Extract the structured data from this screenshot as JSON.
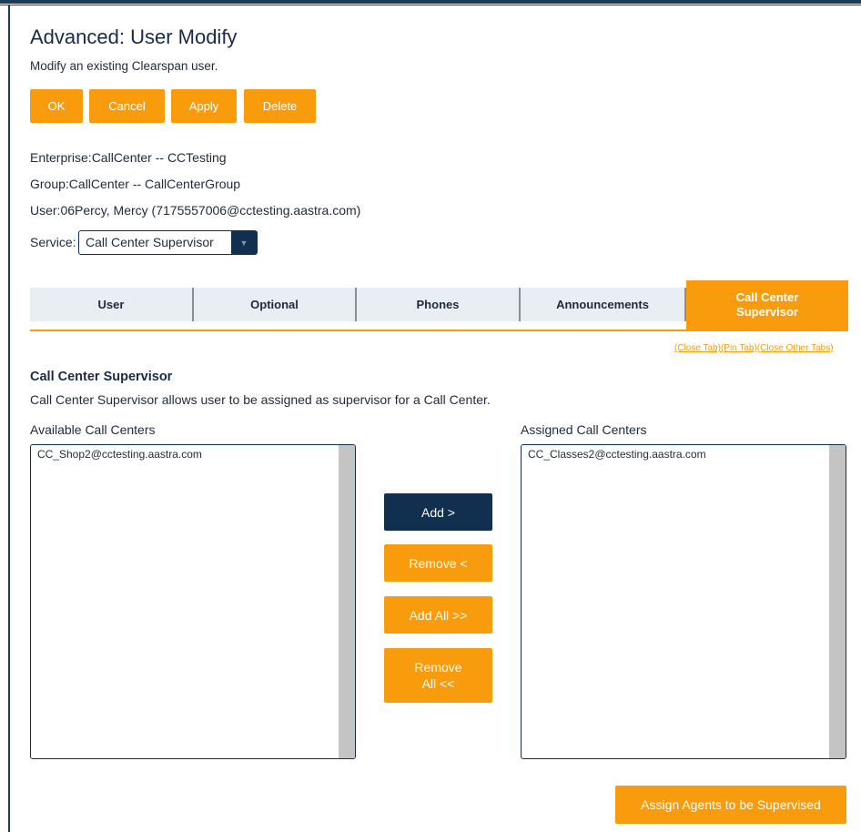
{
  "page": {
    "title": "Advanced: User Modify",
    "subtitle": "Modify an existing Clearspan user."
  },
  "actions": {
    "ok": "OK",
    "cancel": "Cancel",
    "apply": "Apply",
    "delete": "Delete"
  },
  "info": {
    "enterprise": "Enterprise:CallCenter -- CCTesting",
    "group": "Group:CallCenter -- CallCenterGroup",
    "user": "User:06Percy, Mercy (7175557006@cctesting.aastra.com)"
  },
  "service": {
    "label": "Service:",
    "selected": "Call Center Supervisor"
  },
  "tabs": [
    {
      "label": "User"
    },
    {
      "label": "Optional"
    },
    {
      "label": "Phones"
    },
    {
      "label": "Announcements"
    },
    {
      "label": "Call Center Supervisor",
      "active": true
    }
  ],
  "tab_links": {
    "close_tab": "(Close Tab)",
    "pin_tab": "(Pin Tab)",
    "close_other_tabs": "(Close Other Tabs)"
  },
  "section": {
    "title": "Call Center Supervisor",
    "description": "Call Center Supervisor allows user to be assigned as supervisor for a Call Center."
  },
  "available": {
    "label": "Available Call Centers",
    "items": [
      "CC_Shop2@cctesting.aastra.com"
    ]
  },
  "assigned": {
    "label": "Assigned Call Centers",
    "items": [
      "CC_Classes2@cctesting.aastra.com"
    ]
  },
  "transfer": {
    "add": "Add >",
    "remove": "Remove <",
    "add_all": "Add All >>",
    "remove_all_line1": "Remove",
    "remove_all_line2": "All <<"
  },
  "footer": {
    "assign_agents": "Assign Agents to be Supervised"
  },
  "colors": {
    "accent": "#f89c0e",
    "dark": "#11304f",
    "tab_bg": "#e9eef3"
  }
}
